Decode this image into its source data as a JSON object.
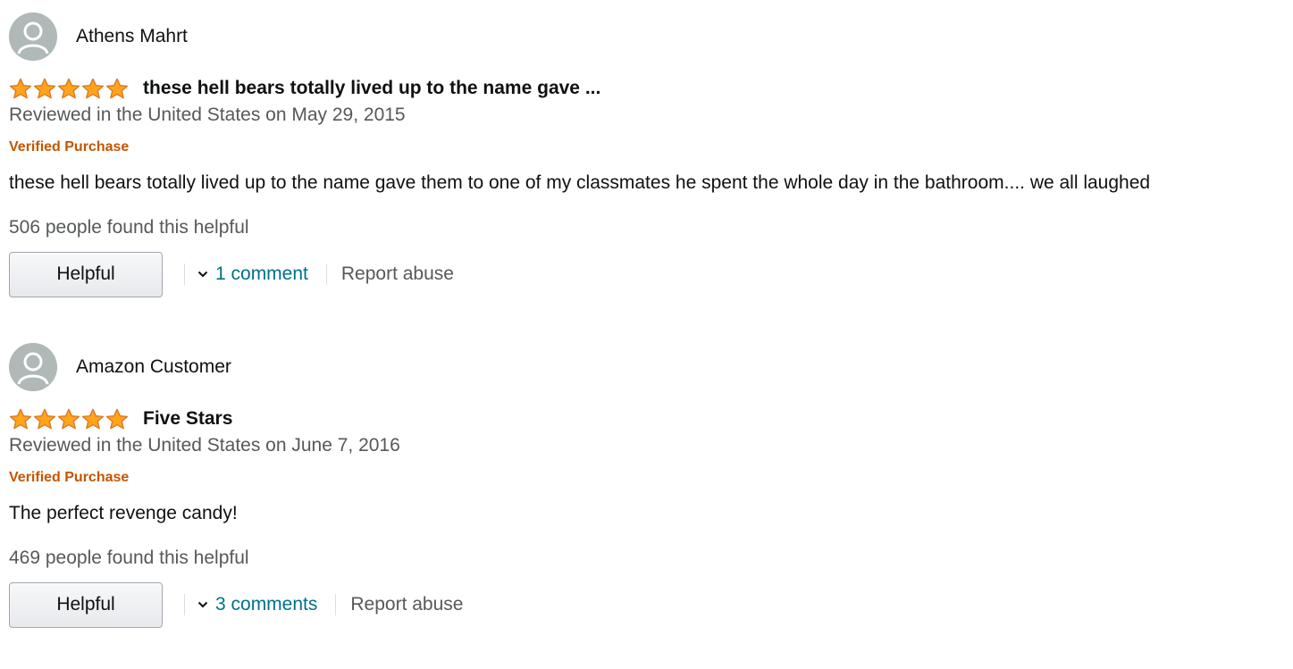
{
  "reviews": [
    {
      "profile_name": "Athens Mahrt",
      "rating": 5,
      "title": "these hell bears totally lived up to the name gave ...",
      "date": "Reviewed in the United States on May 29, 2015",
      "verified": "Verified Purchase",
      "body": "these hell bears totally lived up to the name gave them to one of my classmates he spent the whole day in the bathroom.... we all laughed",
      "helpful_count": "506 people found this helpful",
      "helpful_label": "Helpful",
      "comments_label": "1 comment",
      "report_label": "Report abuse"
    },
    {
      "profile_name": "Amazon Customer",
      "rating": 5,
      "title": "Five Stars",
      "date": "Reviewed in the United States on June 7, 2016",
      "verified": "Verified Purchase",
      "body": "The perfect revenge candy!",
      "helpful_count": "469 people found this helpful",
      "helpful_label": "Helpful",
      "comments_label": "3 comments",
      "report_label": "Report abuse"
    }
  ],
  "colors": {
    "star_fill": "#ffa41c",
    "star_stroke": "#de7921",
    "link": "#007185",
    "verified": "#c45500",
    "muted_text": "#565959",
    "avatar_bg": "#b0b8b8"
  },
  "icons": {
    "avatar": "default-user-avatar-icon",
    "star": "filled-star-icon",
    "chevron": "chevron-down-icon"
  }
}
